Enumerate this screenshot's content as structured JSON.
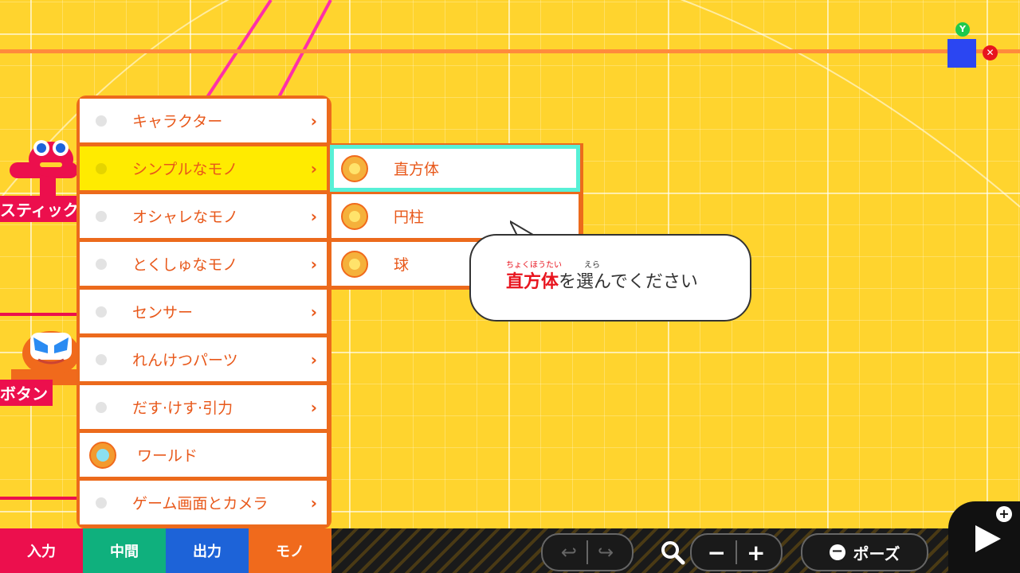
{
  "scene": {
    "left_nodes": [
      {
        "label": "スティック"
      },
      {
        "label": "ボタン"
      }
    ],
    "badges": {
      "y": "Y",
      "x": "✕"
    }
  },
  "menu": {
    "items": [
      {
        "label": "キャラクター",
        "chevron": "›"
      },
      {
        "label": "シンプルなモノ",
        "chevron": "›"
      },
      {
        "label": "オシャレなモノ",
        "chevron": "›"
      },
      {
        "label": "とくしゅなモノ",
        "chevron": "›"
      },
      {
        "label": "センサー",
        "chevron": "›"
      },
      {
        "label": "れんけつパーツ",
        "chevron": "›"
      },
      {
        "label": "だす·けす·引力",
        "chevron": "›"
      },
      {
        "label": "ワールド"
      },
      {
        "label": "ゲーム画面とカメラ",
        "chevron": "›"
      }
    ]
  },
  "submenu": {
    "items": [
      {
        "label": "直方体"
      },
      {
        "label": "円柱"
      },
      {
        "label": "球"
      }
    ]
  },
  "bubble": {
    "ruby_highlight": "ちょくほうたい",
    "ruby_plain": "えら",
    "highlight": "直方体",
    "rest": "を選んでください"
  },
  "bottom_tabs": [
    {
      "label": "入力",
      "color": "#ec0f4d"
    },
    {
      "label": "中間",
      "color": "#0fb07d"
    },
    {
      "label": "出力",
      "color": "#1d63d8"
    },
    {
      "label": "モノ",
      "color": "#f06a1c"
    }
  ],
  "controls": {
    "zoom_minus": "−",
    "zoom_plus": "+",
    "pause_label": "ポーズ",
    "pause_symbol": "−",
    "play_plus": "+"
  }
}
